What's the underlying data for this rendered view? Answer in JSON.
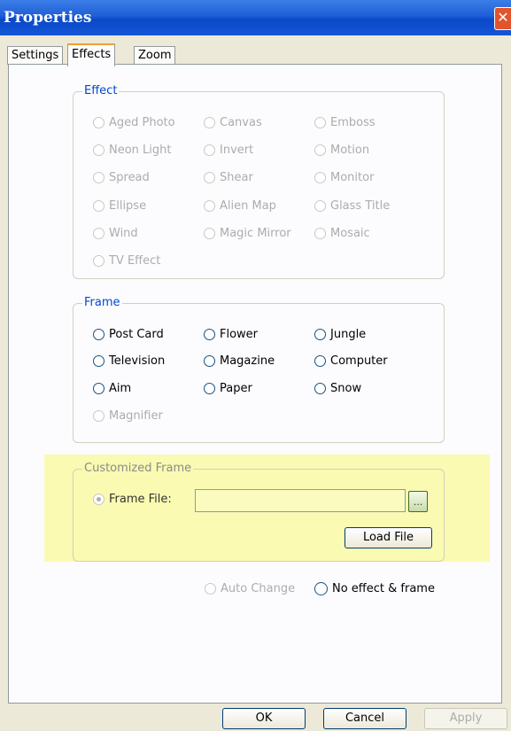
{
  "window": {
    "title": "Properties",
    "close_glyph": "✕"
  },
  "tabs": [
    {
      "label": "Settings",
      "active": false
    },
    {
      "label": "Effects",
      "active": true
    },
    {
      "label": "Zoom",
      "active": false
    }
  ],
  "effect_group": {
    "legend": "Effect",
    "options": [
      "Aged Photo",
      "Canvas",
      "Emboss",
      "Neon Light",
      "Invert",
      "Motion",
      "Spread",
      "Shear",
      "Monitor",
      "Ellipse",
      "Alien Map",
      "Glass Title",
      "Wind",
      "Magic Mirror",
      "Mosaic",
      "TV Effect"
    ]
  },
  "frame_group": {
    "legend": "Frame",
    "options": [
      "Post Card",
      "Flower",
      "Jungle",
      "Television",
      "Magazine",
      "Computer",
      "Aim",
      "Paper",
      "Snow",
      "Magnifier"
    ]
  },
  "custom_frame": {
    "legend": "Customized Frame",
    "radio_label": "Frame File:",
    "input_value": "",
    "browse_label": "...",
    "load_label": "Load File"
  },
  "bottom_options": {
    "auto_change": "Auto Change",
    "no_effect": "No effect & frame"
  },
  "buttons": {
    "ok": "OK",
    "cancel": "Cancel",
    "apply": "Apply"
  },
  "colors": {
    "titlebar": "#0a49c8",
    "legend": "#0046d5",
    "highlight": "#fafab2",
    "tab_accent": "#f0a030"
  }
}
